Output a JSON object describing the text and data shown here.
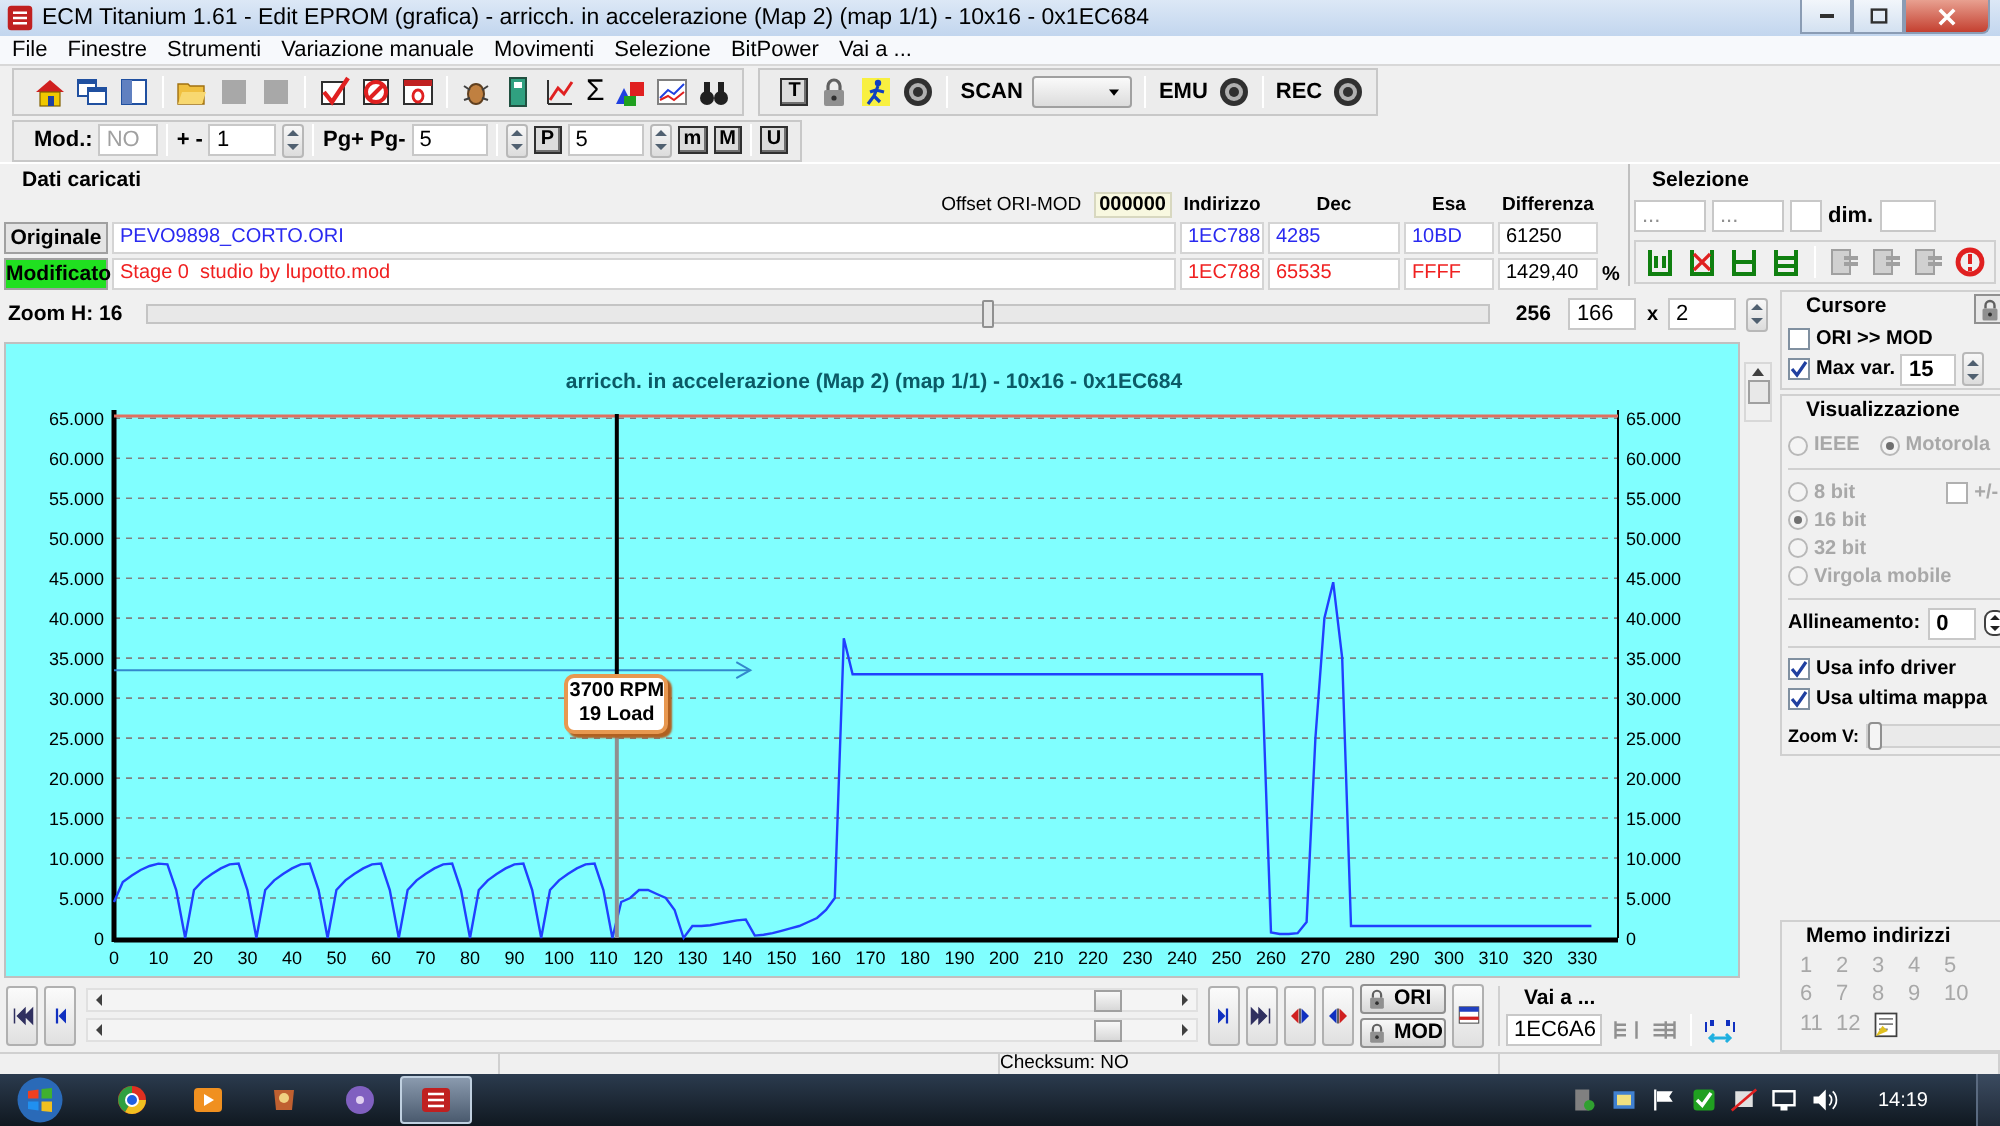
{
  "window": {
    "title": "ECM Titanium 1.61 - Edit EPROM (grafica) - arricch. in accelerazione (Map 2) (map 1/1) - 10x16 - 0x1EC684"
  },
  "menu": [
    "File",
    "Finestre",
    "Strumenti",
    "Variazione manuale",
    "Movimenti",
    "Selezione",
    "BitPower",
    "Vai a ..."
  ],
  "toolbar_1": {
    "sum_button": "Σ",
    "t_button": "T",
    "scan_label": "SCAN",
    "emu_label": "EMU",
    "rec_label": "REC"
  },
  "toolbar_2": {
    "mod_label": "Mod.:",
    "mod_field": {
      "value": "NO",
      "disabled": true
    },
    "step_label": "+ -",
    "step_field": {
      "value": "1"
    },
    "page_label": "Pg+ Pg-",
    "page_field": {
      "value": "5"
    },
    "p_button": "P",
    "p_field": {
      "value": "5"
    },
    "buttons": [
      "m",
      "M",
      "U"
    ]
  },
  "dati_caricati": {
    "title": "Dati caricati",
    "offset_label": "Offset ORI-MOD",
    "offset_value": "000000",
    "columns": [
      "Indirizzo",
      "Dec",
      "Esa",
      "Differenza"
    ],
    "rows": [
      {
        "label": "Originale",
        "active": false,
        "file": "PEVO9898_CORTO.ORI",
        "color": "#2a2af0",
        "address": "1EC788",
        "dec": "4285",
        "hex": "10BD",
        "difference": "61250"
      },
      {
        "label": "Modificato",
        "active": true,
        "file": "Stage 0  studio by lupotto.mod",
        "color": "#f02020",
        "address": "1EC788",
        "dec": "65535",
        "hex": "FFFF",
        "difference": "1429,40",
        "unit": "%"
      }
    ]
  },
  "selezione": {
    "title": "Selezione",
    "start_field": "...",
    "end_field": "...",
    "dim_label": "dim."
  },
  "zoom_h": {
    "label": "Zoom H: 16",
    "level": 0.627,
    "max": "256",
    "value": "166",
    "times": "x",
    "factor": "2"
  },
  "chart": {
    "chart_data": {
      "type": "line",
      "title": "arricch. in accelerazione (Map 2) (map 1/1) - 10x16 - 0x1EC684",
      "x": [
        0,
        2,
        4,
        6,
        8,
        10,
        12,
        14,
        16,
        18,
        20,
        22,
        24,
        26,
        28,
        30,
        32,
        34,
        36,
        38,
        40,
        42,
        44,
        46,
        48,
        50,
        52,
        54,
        56,
        58,
        60,
        62,
        64,
        66,
        68,
        70,
        72,
        74,
        76,
        78,
        80,
        82,
        84,
        86,
        88,
        90,
        92,
        94,
        96,
        98,
        100,
        102,
        104,
        106,
        108,
        110,
        112,
        114,
        116,
        118,
        120,
        122,
        124,
        126,
        128,
        130,
        132,
        134,
        136,
        138,
        140,
        142,
        144,
        146,
        148,
        150,
        152,
        154,
        156,
        158,
        160,
        162,
        164,
        166,
        258,
        260,
        262,
        264,
        266,
        268,
        270,
        272,
        274,
        276,
        278,
        280,
        332
      ],
      "series": [
        {
          "color": "#2040ff",
          "values": [
            4.5,
            7,
            7.8,
            8.5,
            9,
            9.3,
            9.2,
            6,
            0,
            6,
            7.2,
            8,
            8.7,
            9.2,
            9.3,
            6,
            0,
            6,
            7.2,
            8,
            8.7,
            9.2,
            9.3,
            6,
            0,
            6,
            7.2,
            8,
            8.7,
            9.2,
            9.3,
            6,
            0,
            6,
            7.2,
            8,
            8.7,
            9.2,
            9.3,
            6,
            0,
            6,
            7.2,
            8,
            8.7,
            9.2,
            9.3,
            6,
            0,
            6,
            7.2,
            8,
            8.7,
            9.2,
            9.3,
            6,
            0,
            4.5,
            5,
            6,
            6,
            5.5,
            5,
            3.5,
            0,
            1.5,
            1.5,
            1.6,
            1.8,
            2,
            2.2,
            2.3,
            0.3,
            0.4,
            0.6,
            0.9,
            1.2,
            1.5,
            2,
            2.5,
            3.5,
            5,
            37.5,
            33,
            33,
            0.7,
            0.5,
            0.5,
            0.6,
            2,
            25,
            40,
            44.5,
            35,
            1.5,
            1.5,
            1.5
          ]
        }
      ],
      "xlim": [
        0,
        338
      ],
      "ylim": [
        0,
        65.535
      ],
      "xticks": [
        0,
        10,
        20,
        30,
        40,
        50,
        60,
        70,
        80,
        90,
        100,
        110,
        120,
        130,
        140,
        150,
        160,
        170,
        180,
        190,
        200,
        210,
        220,
        230,
        240,
        250,
        260,
        270,
        280,
        290,
        300,
        310,
        320,
        330
      ],
      "yticks": [
        {
          "value": 0,
          "label": "0"
        },
        {
          "value": 5,
          "label": "5.000"
        },
        {
          "value": 10,
          "label": "10.000"
        },
        {
          "value": 15,
          "label": "15.000"
        },
        {
          "value": 20,
          "label": "20.000"
        },
        {
          "value": 25,
          "label": "25.000"
        },
        {
          "value": 30,
          "label": "30.000"
        },
        {
          "value": 35,
          "label": "35.000"
        },
        {
          "value": 40,
          "label": "40.000"
        },
        {
          "value": 45,
          "label": "45.000"
        },
        {
          "value": 50,
          "label": "50.000"
        },
        {
          "value": 55,
          "label": "55.000"
        },
        {
          "value": 60,
          "label": "60.000"
        },
        {
          "value": 65,
          "label": "65.000"
        }
      ],
      "grid": true,
      "annotations": [
        "3700 RPM\n19 Load"
      ]
    }
  },
  "cursore": {
    "title": "Cursore",
    "ori_mod": {
      "label": "ORI >> MOD",
      "checked": false
    },
    "max_var": {
      "label": "Max var.",
      "checked": true,
      "value": "15"
    }
  },
  "visualizzazione": {
    "title": "Visualizzazione",
    "disabled": true,
    "byte_order": [
      {
        "label": "IEEE",
        "selected": false
      },
      {
        "label": "Motorola",
        "selected": true
      }
    ],
    "sign": {
      "label": "+/-",
      "checked": false
    },
    "formats": [
      {
        "label": "8 bit",
        "selected": false
      },
      {
        "label": "16 bit",
        "selected": true
      },
      {
        "label": "32 bit",
        "selected": false
      },
      {
        "label": "Virgola mobile",
        "selected": false
      }
    ],
    "alignment": {
      "label": "Allineamento:",
      "value": "0"
    },
    "options": [
      {
        "label": "Usa info driver",
        "checked": true
      },
      {
        "label": "Usa ultima mappa",
        "checked": true
      }
    ],
    "zoom_v": {
      "label": "Zoom V:",
      "level": 0
    }
  },
  "navigation": {
    "ori_button": "ORI",
    "mod_button": "MOD"
  },
  "goto": {
    "title": "Vai a ...",
    "value": "1EC6A6"
  },
  "memo": {
    "title": "Memo indirizzi",
    "disabled": true,
    "slots": [
      "1",
      "2",
      "3",
      "4",
      "5",
      "6",
      "7",
      "8",
      "9",
      "10",
      "11",
      "12"
    ]
  },
  "status_bar": {
    "checksum": "Checksum: NO"
  },
  "taskbar": {
    "apps": [
      {
        "kind": "browser",
        "selected": false
      },
      {
        "kind": "media",
        "selected": false
      },
      {
        "kind": "game",
        "selected": false
      },
      {
        "kind": "disc",
        "selected": false
      },
      {
        "kind": "ecm",
        "selected": true
      }
    ],
    "clock": "14:19"
  }
}
